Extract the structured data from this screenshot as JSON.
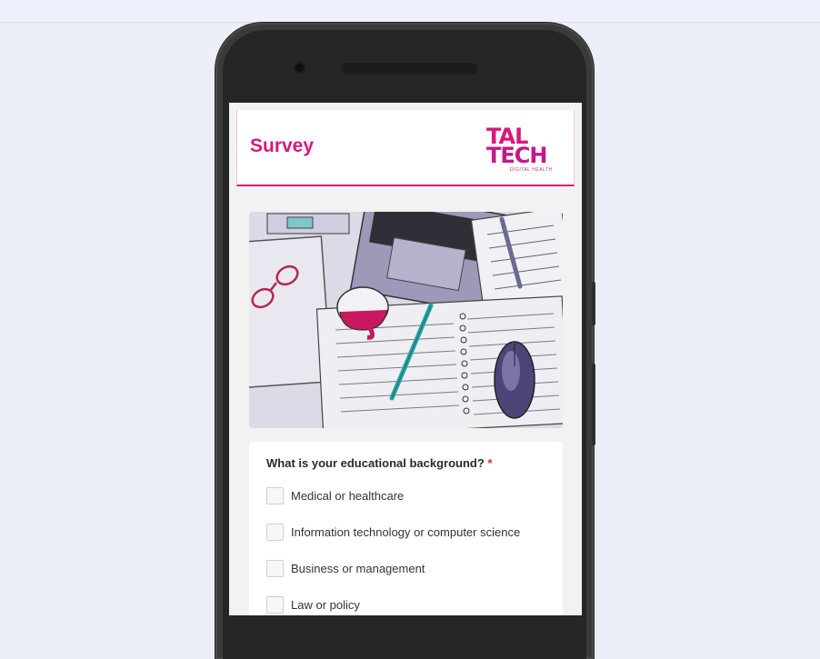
{
  "page": {
    "background": "#eceff8"
  },
  "form": {
    "title": "Survey",
    "accent_color": "#d8187a",
    "logo": {
      "line1": "TAL",
      "line2": "TECH",
      "subtitle": "DIGITAL HEALTH"
    },
    "hero_image": "desk-illustration-laptop-notebook-pen-mouse-glasses-mug",
    "question": {
      "text": "What is your educational background?",
      "required_marker": "*",
      "options": [
        {
          "label": "Medical or healthcare",
          "checked": false
        },
        {
          "label": "Information technology or computer science",
          "checked": false
        },
        {
          "label": "Business or management",
          "checked": false
        },
        {
          "label": "Law or policy",
          "checked": false
        }
      ]
    }
  }
}
